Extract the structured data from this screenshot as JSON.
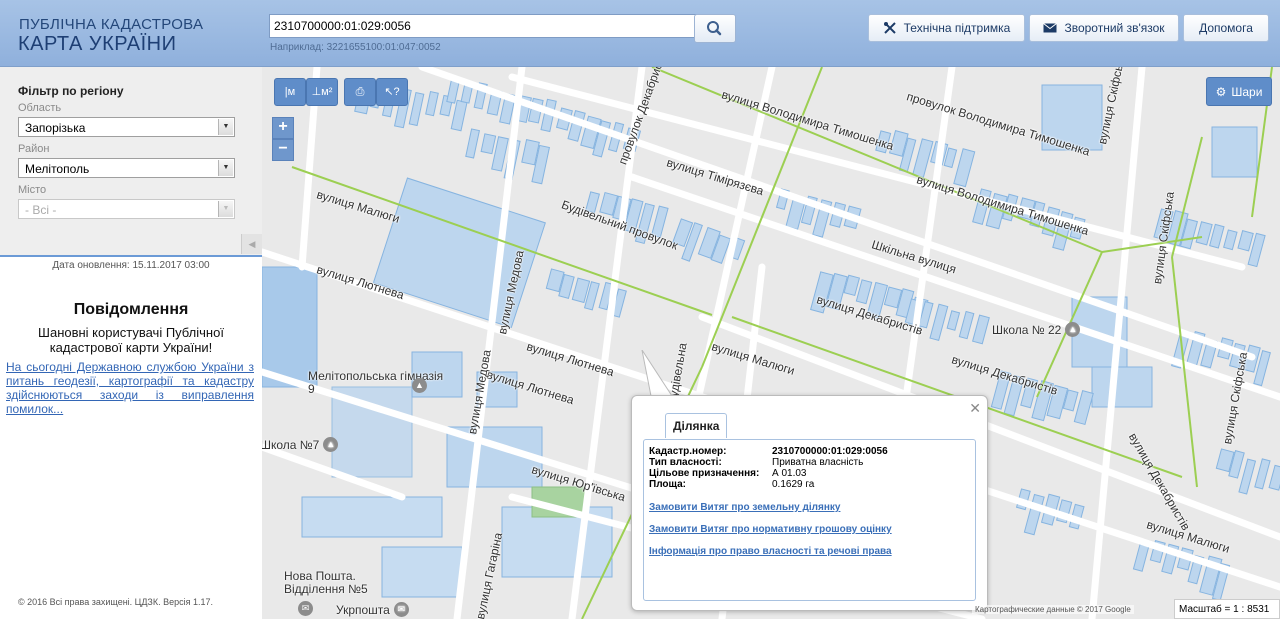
{
  "header": {
    "logo_line1": "ПУБЛІЧНА КАДАСТРОВА",
    "logo_line2": "КАРТА УКРАЇНИ",
    "search_value": "2310700000:01:029:0056",
    "search_hint": "Наприклад: 3221655100:01:047:0052",
    "search_icon": "magnifier-icon",
    "buttons": [
      {
        "label": "Технічна підтримка",
        "icon": "tools-icon"
      },
      {
        "label": "Зворотний зв'язок",
        "icon": "envelope-icon"
      },
      {
        "label": "Допомога",
        "icon": ""
      }
    ]
  },
  "sidebar": {
    "filter_title": "Фільтр по регіону",
    "region_label": "Область",
    "region_value": "Запорізька",
    "district_label": "Район",
    "district_value": "Мелітополь",
    "city_label": "Місто",
    "city_value": "- Всі -",
    "update_date": "Дата оновлення: 15.11.2017 03:00",
    "notice_title": "Повідомлення",
    "notice_text": "Шановні користувачі Публічної кадастрової карти України!",
    "notice_link": "На сьогодні Державною службою України з питань геодезії, картографії та кадастру здійснюються заходи із виправлення помилок...",
    "copyright": "© 2016 Всі права захищені. ЦДЗК. Версія 1.17."
  },
  "map": {
    "toolbar": [
      {
        "name": "measure-length-tool",
        "label": "|м"
      },
      {
        "name": "measure-area-tool",
        "label": "⊥м²"
      },
      {
        "name": "print-tool",
        "label": "⎙"
      },
      {
        "name": "identify-tool",
        "label": "↖?"
      }
    ],
    "zoom_in": "+",
    "zoom_out": "−",
    "layers_label": "Шари",
    "streets": [
      "вулиця Малюги",
      "вулиця Лютнева",
      "вулиця Медова",
      "провулок Декабристів",
      "вулиця Тімірязєва",
      "вулиця Володимира Тимошенка",
      "провулок Володимира Тимошенка",
      "вулиця Володимира Тимошенка",
      "Будівельний провулок",
      "Шкільна вулиця",
      "вулиця Декабристів",
      "вулиця Декабристів",
      "вулиця Малюги",
      "вулиця Лютнева",
      "вулиця Юр'ївська",
      "вулиця Скіфська",
      "вулиця Скіфська",
      "вулиця Скіфська",
      "вулиця Малюги",
      "вулиця Гагаріна",
      "вулиця Лютнева",
      "вулиця Медова",
      "Будівельна",
      "вулиця Декабристів"
    ],
    "pois": [
      {
        "label": "Школа № 22",
        "icon": "school-icon"
      },
      {
        "label": "Мелітопольська гімназія 9",
        "icon": "school-icon"
      },
      {
        "label": "Школа №7",
        "icon": "school-icon"
      },
      {
        "label": "Нова Пошта. Відділення №5",
        "icon": "post-icon"
      },
      {
        "label": "Укрпошта",
        "icon": "post-icon"
      }
    ],
    "popup": {
      "tab": "Ділянка",
      "rows": [
        {
          "key": "Кадастр.номер:",
          "value": "2310700000:01:029:0056"
        },
        {
          "key": "Тип власності:",
          "value": "Приватна власність"
        },
        {
          "key": "Цільове призначення:",
          "value": "А 01.03"
        },
        {
          "key": "Площа:",
          "value": "0.1629 га"
        }
      ],
      "links": [
        "Замовити Витяг про земельну ділянку",
        "Замовити Витяг про нормативну грошову оцінку",
        "Інформація про право власності та речові права"
      ]
    },
    "attribution": "Картографические данные © 2017 Google",
    "scale": "Масштаб = 1 : 8531"
  },
  "colors": {
    "header_bg": "#98b6e0",
    "parcel_fill": "#b7d3ef",
    "parcel_stroke": "#7fb0e0",
    "green_road": "#9ccf52",
    "road": "#ffffff",
    "accent": "#5f8dc9"
  }
}
